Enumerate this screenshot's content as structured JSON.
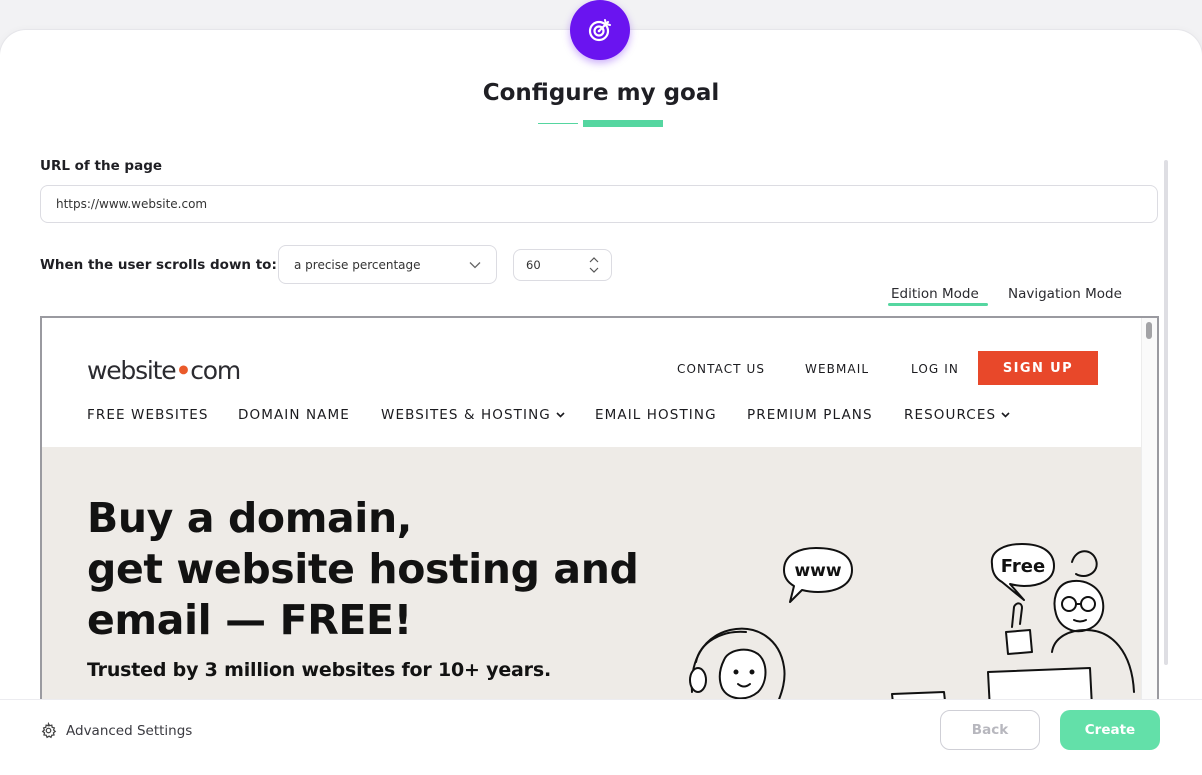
{
  "dialog": {
    "title": "Configure my goal",
    "badge_icon": "target-icon"
  },
  "url_field": {
    "label": "URL of the page",
    "value": "https://www.website.com"
  },
  "scroll_condition": {
    "label": "When the user scrolls down to:",
    "mode_select": {
      "selected": "a precise percentage"
    },
    "percentage": {
      "value": "60"
    }
  },
  "mode_tabs": [
    {
      "label": "Edition Mode",
      "active": true
    },
    {
      "label": "Navigation Mode",
      "active": false
    }
  ],
  "preview": {
    "logo": {
      "part1": "website",
      "part2": "com"
    },
    "top_links": [
      "CONTACT US",
      "WEBMAIL",
      "LOG IN"
    ],
    "signup": "SIGN UP",
    "main_nav": [
      "FREE WEBSITES",
      "DOMAIN NAME",
      "WEBSITES & HOSTING",
      "EMAIL HOSTING",
      "PREMIUM PLANS",
      "RESOURCES"
    ],
    "hero": {
      "line1": "Buy a domain,",
      "line2": "get website hosting and",
      "line3": "email — FREE!",
      "subtitle": "Trusted by 3 million websites for 10+ years."
    },
    "bubbles": {
      "left": "www",
      "right": "Free"
    }
  },
  "footer": {
    "advanced": "Advanced Settings",
    "back": "Back",
    "create": "Create"
  },
  "colors": {
    "accent": "#6a14f0",
    "green": "#55d6a0",
    "signup": "#e8482a",
    "hero_bg": "#eeebe7"
  }
}
